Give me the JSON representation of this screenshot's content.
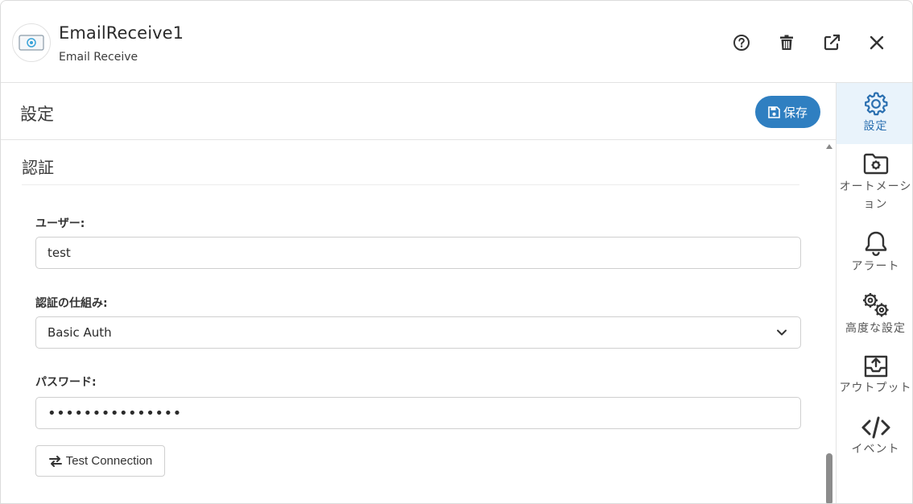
{
  "header": {
    "title": "EmailReceive1",
    "subtitle": "Email Receive",
    "icons": [
      "help-icon",
      "trash-icon",
      "external-link-icon",
      "close-icon"
    ]
  },
  "section": {
    "title": "設定",
    "save_label": "保存"
  },
  "auth": {
    "title": "認証",
    "user_label": "ユーザー:",
    "user_value": "test",
    "mechanism_label": "認証の仕組み:",
    "mechanism_value": "Basic Auth",
    "password_label": "パスワード:",
    "password_value": "•••••••••••••••",
    "test_button": "Test Connection"
  },
  "sidebar": {
    "items": [
      {
        "label": "設定",
        "icon": "gear-icon",
        "active": true
      },
      {
        "label": "オートメーション",
        "icon": "folder-gear-icon",
        "active": false
      },
      {
        "label": "アラート",
        "icon": "bell-icon",
        "active": false
      },
      {
        "label": "高度な設定",
        "icon": "gears-icon",
        "active": false
      },
      {
        "label": "アウトプット",
        "icon": "upload-tray-icon",
        "active": false
      },
      {
        "label": "イベント",
        "icon": "code-icon",
        "active": false
      }
    ]
  },
  "colors": {
    "accent": "#2f7fc1",
    "active_bg": "#e9f3fb"
  }
}
